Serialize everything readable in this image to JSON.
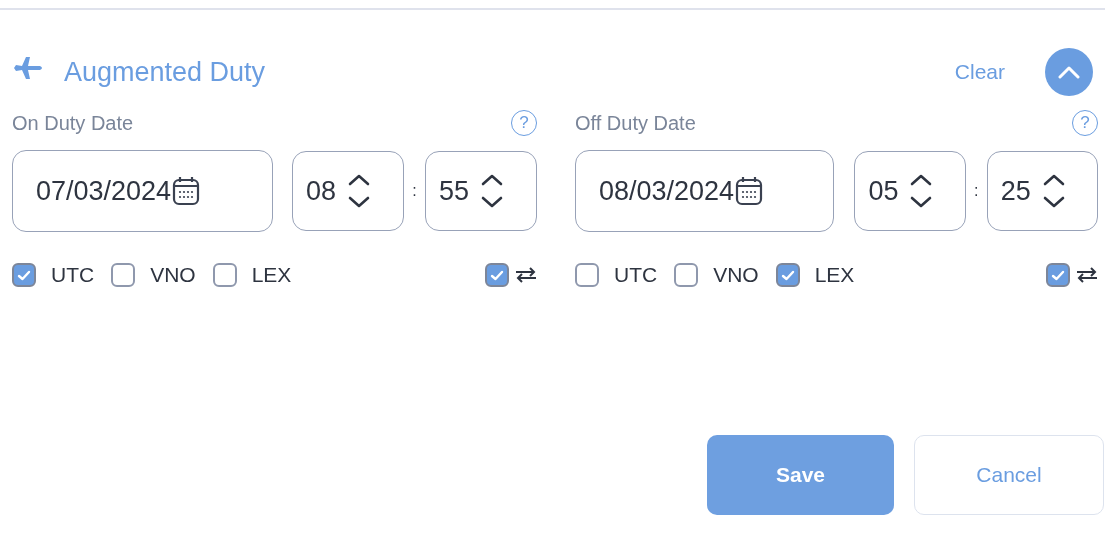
{
  "section": {
    "title": "Augmented Duty",
    "clear_label": "Clear",
    "expanded": true
  },
  "duty_dates": [
    {
      "label": "On Duty Date",
      "help": "?",
      "date": "07/03/2024",
      "hour": "08",
      "separator": ":",
      "minute": "55",
      "zones": [
        {
          "label": "UTC",
          "checked": true
        },
        {
          "label": "VNO",
          "checked": false
        },
        {
          "label": "LEX",
          "checked": false
        }
      ],
      "swap_checked": true
    },
    {
      "label": "Off Duty Date",
      "help": "?",
      "date": "08/03/2024",
      "hour": "05",
      "separator": ":",
      "minute": "25",
      "zones": [
        {
          "label": "UTC",
          "checked": false
        },
        {
          "label": "VNO",
          "checked": false
        },
        {
          "label": "LEX",
          "checked": true
        }
      ],
      "swap_checked": true
    }
  ],
  "buttons": [
    {
      "label": "Save",
      "kind": "primary"
    },
    {
      "label": "Cancel",
      "kind": "secondary"
    }
  ]
}
